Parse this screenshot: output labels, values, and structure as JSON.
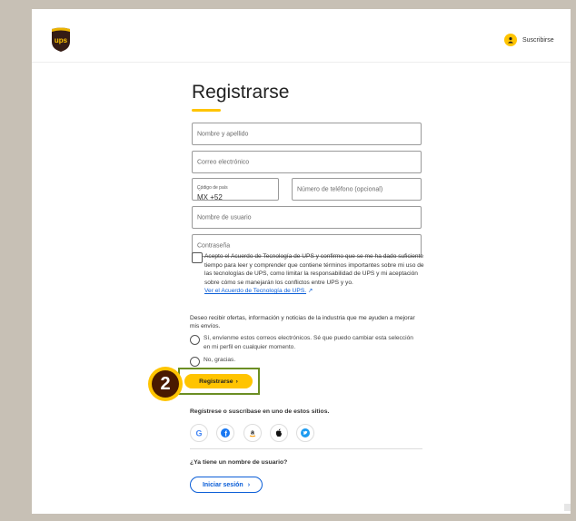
{
  "header": {
    "brand": "ups",
    "subscribe_label": "Suscribirse",
    "brand_color": "#351c15",
    "accent_color": "#ffc400"
  },
  "form": {
    "title": "Registrarse",
    "name_placeholder": "Nombre y apellido",
    "email_placeholder": "Correo electrónico",
    "country_code_label": "Código de país",
    "country_code_value": "MX +52",
    "phone_placeholder": "Número de teléfono (opcional)",
    "username_placeholder": "Nombre de usuario",
    "password_placeholder": "Contraseña",
    "terms_text": "Acepto el Acuerdo de Tecnología de UPS y confirmo que se me ha dado suficiente tiempo para leer y comprender que contiene términos importantes sobre mi uso de las tecnologías de UPS, como limitar la responsabilidad de UPS y mi aceptación sobre cómo se manejarán los conflictos entre UPS y yo.",
    "terms_link": "Ver el Acuerdo de Tecnología de UPS.",
    "offers_question": "Deseo recibir ofertas, información y noticias de la industria que me ayuden a mejorar mis envíos.",
    "offer_yes": "Sí, envíenme estos correos electrónicos. Sé que puedo cambiar esta selección en mi perfil en cualquier momento.",
    "offer_no": "No, gracias.",
    "submit_label": "Registrarse",
    "step_number": "2",
    "social_heading": "Regístrese o suscríbase en uno de estos sitios.",
    "have_username": "¿Ya tiene un nombre de usuario?",
    "login_label": "Iniciar sesión"
  },
  "social_icons": [
    "google-icon",
    "facebook-icon",
    "amazon-icon",
    "apple-icon",
    "twitter-icon"
  ]
}
